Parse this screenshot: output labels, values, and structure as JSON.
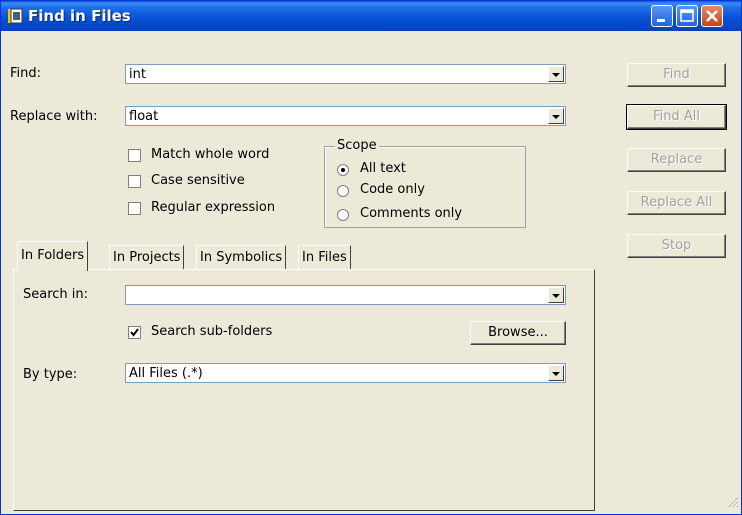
{
  "window": {
    "title": "Find in Files",
    "icon": "folder-find-icon"
  },
  "form": {
    "find_label": "Find:",
    "find_value": "int",
    "replace_label": "Replace with:",
    "replace_value": "float",
    "options": [
      {
        "label": "Match whole word",
        "checked": false
      },
      {
        "label": "Case sensitive",
        "checked": false
      },
      {
        "label": "Regular expression",
        "checked": false
      }
    ]
  },
  "scope": {
    "title": "Scope",
    "options": [
      {
        "label": "All text",
        "selected": true
      },
      {
        "label": "Code only",
        "selected": false
      },
      {
        "label": "Comments only",
        "selected": false
      }
    ]
  },
  "tabs": [
    {
      "label": "In Folders",
      "active": true
    },
    {
      "label": "In Projects",
      "active": false
    },
    {
      "label": "In Symbolics",
      "active": false
    },
    {
      "label": "In Files",
      "active": false
    }
  ],
  "folders": {
    "search_in_label": "Search in:",
    "search_in_value": "",
    "subfolders_label": "Search sub-folders",
    "subfolders_checked": true,
    "browse_label": "Browse...",
    "by_type_label": "By type:",
    "by_type_value": "All Files (.*)"
  },
  "actions": [
    {
      "label": "Find",
      "enabled": false
    },
    {
      "label": "Find All",
      "enabled": false,
      "default": true
    },
    {
      "label": "Replace",
      "enabled": false
    },
    {
      "label": "Replace All",
      "enabled": false
    },
    {
      "label": "Stop",
      "enabled": false
    }
  ],
  "colors": {
    "titlebar": "#0752d6",
    "dialog_face": "#ece9d8",
    "close_button": "#c6411b"
  }
}
